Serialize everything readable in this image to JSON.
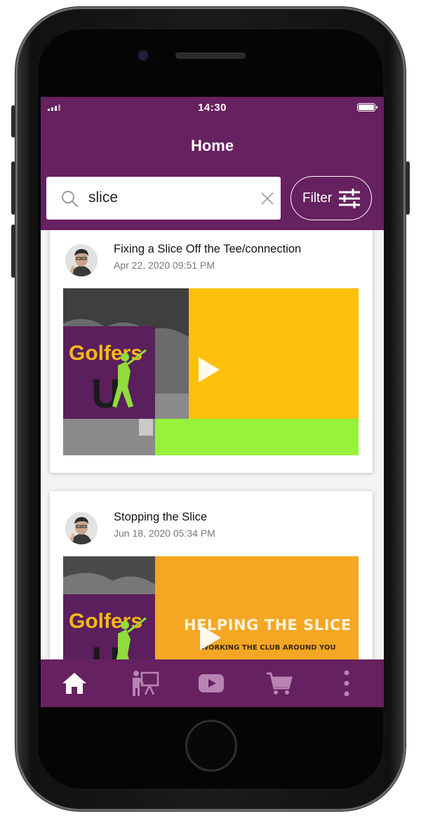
{
  "status_bar": {
    "time": "14:30"
  },
  "header": {
    "title": "Home"
  },
  "search": {
    "value": "slice",
    "placeholder": ""
  },
  "filter": {
    "label": "Filter"
  },
  "posts": [
    {
      "title": "Fixing a Slice Off the Tee/connection",
      "date": "Apr 22, 2020 09:51 PM",
      "thumbnail": {
        "logo_text": "Golfers",
        "logo_letter": "U",
        "caption": "",
        "subcaption": ""
      }
    },
    {
      "title": "Stopping the Slice",
      "date": "Jun 18, 2020 05:34 PM",
      "thumbnail": {
        "logo_text": "Golfers",
        "logo_letter": "U",
        "caption": "HELPING THE SLICE",
        "subcaption": "WORKING THE CLUB AROUND YOU"
      }
    }
  ],
  "bottom_nav": [
    {
      "icon": "home-icon",
      "active": true
    },
    {
      "icon": "lesson-presentation-icon",
      "active": false
    },
    {
      "icon": "video-play-icon",
      "active": false
    },
    {
      "icon": "shopping-cart-icon",
      "active": false
    },
    {
      "icon": "more-vertical-icon",
      "active": false
    }
  ],
  "colors": {
    "brand_purple": "#662160",
    "nav_inactive": "#b884b3",
    "thumb_yellow": "#fcc00a",
    "thumb_lime": "#97f23a",
    "thumb_orange": "#f5a623",
    "logo_purple": "#5a1f5c",
    "logo_yellow": "#f6b719",
    "logo_green": "#8fdc3c"
  }
}
